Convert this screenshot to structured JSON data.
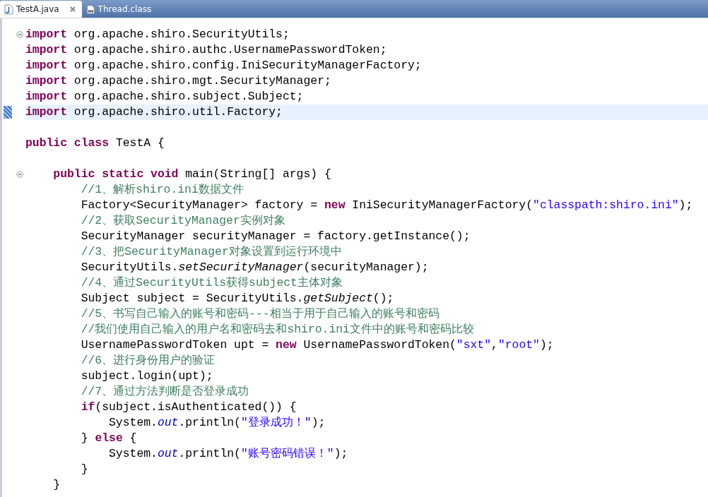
{
  "tabs": [
    {
      "label": "TestA.java",
      "selected": true,
      "kind": "source"
    },
    {
      "label": "Thread.class",
      "selected": false,
      "kind": "binary"
    }
  ],
  "lines": [
    {
      "fold": true,
      "changed": false,
      "current": false,
      "tokens": [
        {
          "kind": "keyword",
          "text": "import"
        },
        {
          "kind": "plain",
          "text": " org.apache.shiro.SecurityUtils;"
        }
      ]
    },
    {
      "fold": false,
      "changed": false,
      "current": false,
      "tokens": [
        {
          "kind": "keyword",
          "text": "import"
        },
        {
          "kind": "plain",
          "text": " org.apache.shiro.authc.UsernamePasswordToken;"
        }
      ]
    },
    {
      "fold": false,
      "changed": false,
      "current": false,
      "tokens": [
        {
          "kind": "keyword",
          "text": "import"
        },
        {
          "kind": "plain",
          "text": " org.apache.shiro.config.IniSecurityManagerFactory;"
        }
      ]
    },
    {
      "fold": false,
      "changed": false,
      "current": false,
      "tokens": [
        {
          "kind": "keyword",
          "text": "import"
        },
        {
          "kind": "plain",
          "text": " org.apache.shiro.mgt.SecurityManager;"
        }
      ]
    },
    {
      "fold": false,
      "changed": false,
      "current": false,
      "tokens": [
        {
          "kind": "keyword",
          "text": "import"
        },
        {
          "kind": "plain",
          "text": " org.apache.shiro.subject.Subject;"
        }
      ]
    },
    {
      "fold": false,
      "changed": true,
      "current": true,
      "tokens": [
        {
          "kind": "keyword",
          "text": "import"
        },
        {
          "kind": "plain",
          "text": " org.apache.shiro.util.Factory;"
        }
      ]
    },
    {
      "fold": false,
      "changed": false,
      "current": false
    },
    {
      "fold": false,
      "changed": false,
      "current": false,
      "tokens": [
        {
          "kind": "keyword",
          "text": "public class"
        },
        {
          "kind": "plain",
          "text": " TestA {"
        }
      ]
    },
    {
      "fold": false,
      "changed": false,
      "current": false
    },
    {
      "fold": true,
      "changed": false,
      "current": false,
      "tokens": [
        {
          "kind": "keyword",
          "text": "    public static void"
        },
        {
          "kind": "plain",
          "text": " main(String[] args) {"
        }
      ]
    },
    {
      "fold": false,
      "changed": false,
      "current": false,
      "tokens": [
        {
          "kind": "comment",
          "text": "        //1、解析shiro.ini数据文件"
        }
      ]
    },
    {
      "fold": false,
      "changed": false,
      "current": false,
      "tokens": [
        {
          "kind": "plain",
          "text": "        Factory<SecurityManager> factory = "
        },
        {
          "kind": "keyword",
          "text": "new"
        },
        {
          "kind": "plain",
          "text": " IniSecurityManagerFactory("
        },
        {
          "kind": "string",
          "text": "\"classpath:shiro.ini\""
        },
        {
          "kind": "plain",
          "text": ");"
        }
      ]
    },
    {
      "fold": false,
      "changed": false,
      "current": false,
      "tokens": [
        {
          "kind": "comment",
          "text": "        //2、获取SecurityManager实例对象"
        }
      ]
    },
    {
      "fold": false,
      "changed": false,
      "current": false,
      "tokens": [
        {
          "kind": "plain",
          "text": "        SecurityManager securityManager = factory.getInstance();"
        }
      ]
    },
    {
      "fold": false,
      "changed": false,
      "current": false,
      "tokens": [
        {
          "kind": "comment",
          "text": "        //3、把SecurityManager对象设置到运行环境中"
        }
      ]
    },
    {
      "fold": false,
      "changed": false,
      "current": false,
      "tokens": [
        {
          "kind": "plain",
          "text": "        SecurityUtils."
        },
        {
          "kind": "static",
          "text": "setSecurityManager"
        },
        {
          "kind": "plain",
          "text": "(securityManager);"
        }
      ]
    },
    {
      "fold": false,
      "changed": false,
      "current": false,
      "tokens": [
        {
          "kind": "comment",
          "text": "        //4、通过SecurityUtils获得subject主体对象"
        }
      ]
    },
    {
      "fold": false,
      "changed": false,
      "current": false,
      "tokens": [
        {
          "kind": "plain",
          "text": "        Subject subject = SecurityUtils."
        },
        {
          "kind": "static",
          "text": "getSubject"
        },
        {
          "kind": "plain",
          "text": "();"
        }
      ]
    },
    {
      "fold": false,
      "changed": false,
      "current": false,
      "tokens": [
        {
          "kind": "comment",
          "text": "        //5、书写自己输入的账号和密码---相当于用于自己输入的账号和密码"
        }
      ]
    },
    {
      "fold": false,
      "changed": false,
      "current": false,
      "tokens": [
        {
          "kind": "comment",
          "text": "        //我们使用自己输入的用户名和密码去和shiro.ini文件中的账号和密码比较"
        }
      ]
    },
    {
      "fold": false,
      "changed": false,
      "current": false,
      "tokens": [
        {
          "kind": "plain",
          "text": "        UsernamePasswordToken upt = "
        },
        {
          "kind": "keyword",
          "text": "new"
        },
        {
          "kind": "plain",
          "text": " UsernamePasswordToken("
        },
        {
          "kind": "string",
          "text": "\"sxt\""
        },
        {
          "kind": "plain",
          "text": ","
        },
        {
          "kind": "string",
          "text": "\"root\""
        },
        {
          "kind": "plain",
          "text": ");"
        }
      ]
    },
    {
      "fold": false,
      "changed": false,
      "current": false,
      "tokens": [
        {
          "kind": "comment",
          "text": "        //6、进行身份用户的验证"
        }
      ]
    },
    {
      "fold": false,
      "changed": false,
      "current": false,
      "tokens": [
        {
          "kind": "plain",
          "text": "        subject.login(upt);"
        }
      ]
    },
    {
      "fold": false,
      "changed": false,
      "current": false,
      "tokens": [
        {
          "kind": "comment",
          "text": "        //7、通过方法判断是否登录成功"
        }
      ]
    },
    {
      "fold": false,
      "changed": false,
      "current": false,
      "tokens": [
        {
          "kind": "keyword",
          "text": "        if"
        },
        {
          "kind": "plain",
          "text": "(subject.isAuthenticated()) {"
        }
      ]
    },
    {
      "fold": false,
      "changed": false,
      "current": false,
      "tokens": [
        {
          "kind": "plain",
          "text": "            System."
        },
        {
          "kind": "field",
          "text": "out"
        },
        {
          "kind": "plain",
          "text": ".println("
        },
        {
          "kind": "string",
          "text": "\"登录成功！\""
        },
        {
          "kind": "plain",
          "text": ");"
        }
      ]
    },
    {
      "fold": false,
      "changed": false,
      "current": false,
      "tokens": [
        {
          "kind": "plain",
          "text": "        } "
        },
        {
          "kind": "keyword",
          "text": "else"
        },
        {
          "kind": "plain",
          "text": " {"
        }
      ]
    },
    {
      "fold": false,
      "changed": false,
      "current": false,
      "tokens": [
        {
          "kind": "plain",
          "text": "            System."
        },
        {
          "kind": "field",
          "text": "out"
        },
        {
          "kind": "plain",
          "text": ".println("
        },
        {
          "kind": "string",
          "text": "\"账号密码错误！\""
        },
        {
          "kind": "plain",
          "text": ");"
        }
      ]
    },
    {
      "fold": false,
      "changed": false,
      "current": false,
      "tokens": [
        {
          "kind": "plain",
          "text": "        }"
        }
      ]
    },
    {
      "fold": false,
      "changed": false,
      "current": false,
      "tokens": [
        {
          "kind": "plain",
          "text": "    }"
        }
      ]
    }
  ]
}
